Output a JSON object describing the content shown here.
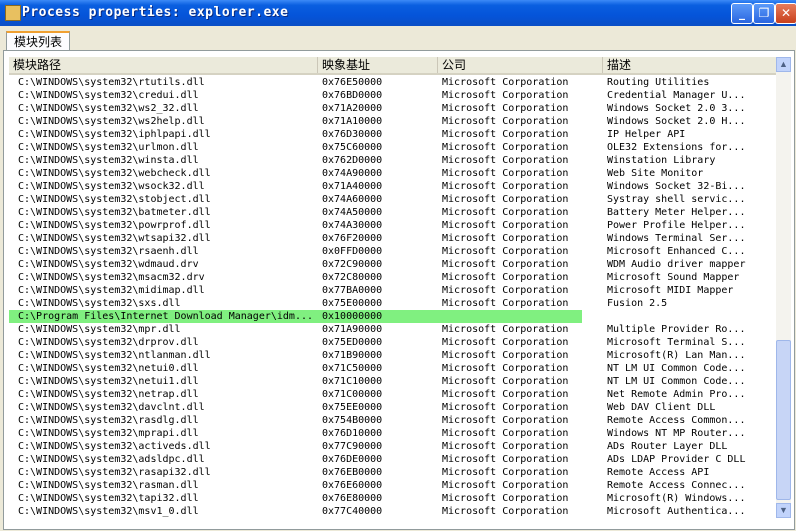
{
  "window": {
    "title": "Process properties: explorer.exe"
  },
  "titlebar": {
    "min": "_",
    "max": "❐",
    "close": "✕"
  },
  "tabs": [
    {
      "label": "模块列表"
    }
  ],
  "table": {
    "headers": [
      "模块路径",
      "映象基址",
      "公司",
      "描述"
    ],
    "rows": [
      [
        "C:\\WINDOWS\\system32\\rtutils.dll",
        "0x76E50000",
        "Microsoft Corporation",
        "Routing Utilities"
      ],
      [
        "C:\\WINDOWS\\system32\\credui.dll",
        "0x76BD0000",
        "Microsoft Corporation",
        "Credential Manager U..."
      ],
      [
        "C:\\WINDOWS\\system32\\ws2_32.dll",
        "0x71A20000",
        "Microsoft Corporation",
        "Windows Socket 2.0 3..."
      ],
      [
        "C:\\WINDOWS\\system32\\ws2help.dll",
        "0x71A10000",
        "Microsoft Corporation",
        "Windows Socket 2.0 H..."
      ],
      [
        "C:\\WINDOWS\\system32\\iphlpapi.dll",
        "0x76D30000",
        "Microsoft Corporation",
        "IP Helper API"
      ],
      [
        "C:\\WINDOWS\\system32\\urlmon.dll",
        "0x75C60000",
        "Microsoft Corporation",
        "OLE32 Extensions for..."
      ],
      [
        "C:\\WINDOWS\\system32\\winsta.dll",
        "0x762D0000",
        "Microsoft Corporation",
        "Winstation Library"
      ],
      [
        "C:\\WINDOWS\\system32\\webcheck.dll",
        "0x74A90000",
        "Microsoft Corporation",
        "Web Site Monitor"
      ],
      [
        "C:\\WINDOWS\\system32\\wsock32.dll",
        "0x71A40000",
        "Microsoft Corporation",
        "Windows Socket 32-Bi..."
      ],
      [
        "C:\\WINDOWS\\system32\\stobject.dll",
        "0x74A60000",
        "Microsoft Corporation",
        "Systray shell servic..."
      ],
      [
        "C:\\WINDOWS\\system32\\batmeter.dll",
        "0x74A50000",
        "Microsoft Corporation",
        "Battery Meter Helper..."
      ],
      [
        "C:\\WINDOWS\\system32\\powrprof.dll",
        "0x74A30000",
        "Microsoft Corporation",
        "Power Profile Helper..."
      ],
      [
        "C:\\WINDOWS\\system32\\wtsapi32.dll",
        "0x76F20000",
        "Microsoft Corporation",
        "Windows Terminal Ser..."
      ],
      [
        "C:\\WINDOWS\\system32\\rsaenh.dll",
        "0x0FFD0000",
        "Microsoft Corporation",
        "Microsoft Enhanced C..."
      ],
      [
        "C:\\WINDOWS\\system32\\wdmaud.drv",
        "0x72C90000",
        "Microsoft Corporation",
        "WDM Audio driver mapper"
      ],
      [
        "C:\\WINDOWS\\system32\\msacm32.drv",
        "0x72C80000",
        "Microsoft Corporation",
        "Microsoft Sound Mapper"
      ],
      [
        "C:\\WINDOWS\\system32\\midimap.dll",
        "0x77BA0000",
        "Microsoft Corporation",
        "Microsoft MIDI Mapper"
      ],
      [
        "C:\\WINDOWS\\system32\\sxs.dll",
        "0x75E00000",
        "Microsoft Corporation",
        "Fusion 2.5"
      ],
      [
        "C:\\Program Files\\Internet Download Manager\\idm...",
        "0x10000000",
        "",
        ""
      ],
      [
        "C:\\WINDOWS\\system32\\mpr.dll",
        "0x71A90000",
        "Microsoft Corporation",
        "Multiple Provider Ro..."
      ],
      [
        "C:\\WINDOWS\\system32\\drprov.dll",
        "0x75ED0000",
        "Microsoft Corporation",
        "Microsoft Terminal S..."
      ],
      [
        "C:\\WINDOWS\\system32\\ntlanman.dll",
        "0x71B90000",
        "Microsoft Corporation",
        "Microsoft(R) Lan Man..."
      ],
      [
        "C:\\WINDOWS\\system32\\netui0.dll",
        "0x71C50000",
        "Microsoft Corporation",
        "NT LM UI Common Code..."
      ],
      [
        "C:\\WINDOWS\\system32\\netui1.dll",
        "0x71C10000",
        "Microsoft Corporation",
        "NT LM UI Common Code..."
      ],
      [
        "C:\\WINDOWS\\system32\\netrap.dll",
        "0x71C00000",
        "Microsoft Corporation",
        "Net Remote Admin Pro..."
      ],
      [
        "C:\\WINDOWS\\system32\\davclnt.dll",
        "0x75EE0000",
        "Microsoft Corporation",
        "Web DAV Client DLL"
      ],
      [
        "C:\\WINDOWS\\system32\\rasdlg.dll",
        "0x754B0000",
        "Microsoft Corporation",
        "Remote Access Common..."
      ],
      [
        "C:\\WINDOWS\\system32\\mprapi.dll",
        "0x76D10000",
        "Microsoft Corporation",
        "Windows NT MP Router..."
      ],
      [
        "C:\\WINDOWS\\system32\\activeds.dll",
        "0x77C90000",
        "Microsoft Corporation",
        "ADs Router Layer DLL"
      ],
      [
        "C:\\WINDOWS\\system32\\adsldpc.dll",
        "0x76DE0000",
        "Microsoft Corporation",
        "ADs LDAP Provider C DLL"
      ],
      [
        "C:\\WINDOWS\\system32\\rasapi32.dll",
        "0x76EB0000",
        "Microsoft Corporation",
        "Remote Access API"
      ],
      [
        "C:\\WINDOWS\\system32\\rasman.dll",
        "0x76E60000",
        "Microsoft Corporation",
        "Remote Access Connec..."
      ],
      [
        "C:\\WINDOWS\\system32\\tapi32.dll",
        "0x76E80000",
        "Microsoft Corporation",
        "Microsoft(R) Windows..."
      ],
      [
        "C:\\WINDOWS\\system32\\msv1_0.dll",
        "0x77C40000",
        "Microsoft Corporation",
        "Microsoft Authentica..."
      ]
    ],
    "highlight_row": 18,
    "highlight_color": "#80f080"
  },
  "scrollbar": {
    "up": "▲",
    "down": "▼"
  }
}
